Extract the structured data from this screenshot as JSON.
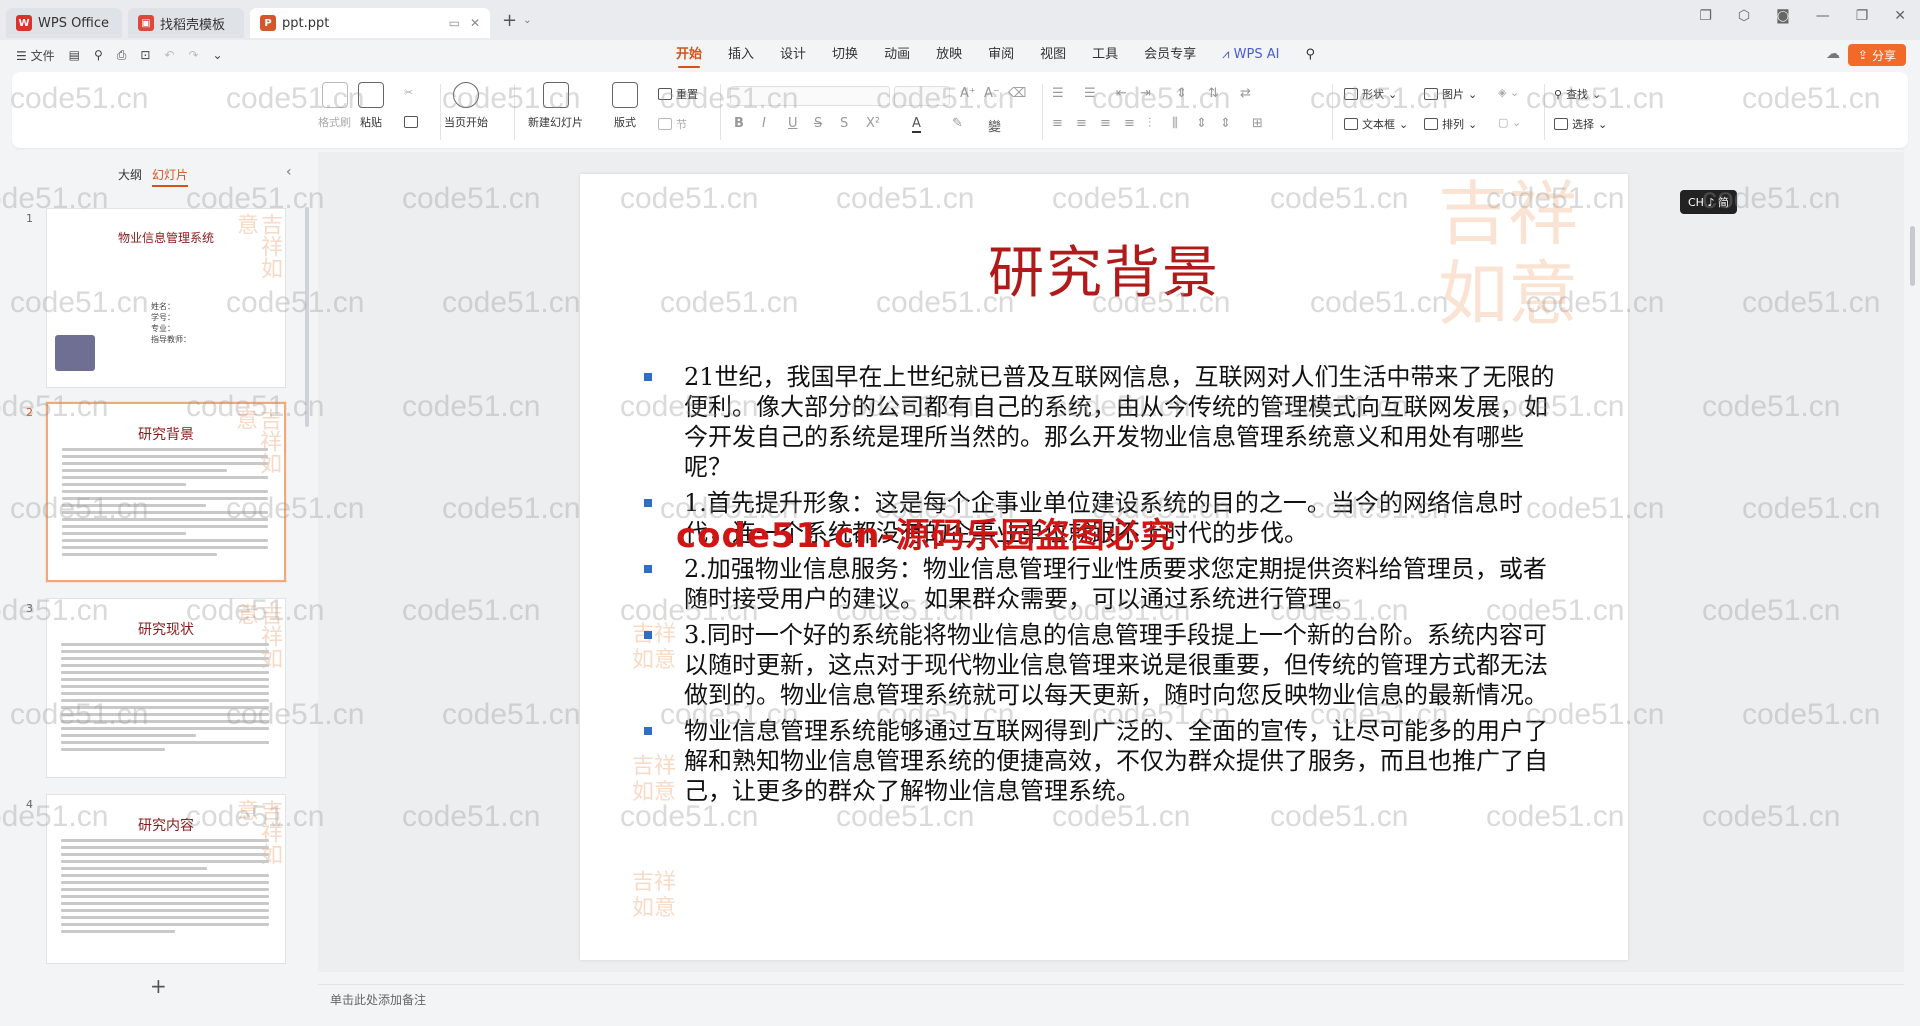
{
  "titlebar": {
    "tabs": [
      {
        "label": "WPS Office",
        "icon": "wps-logo-icon",
        "active": false
      },
      {
        "label": "找稻壳模板",
        "icon": "template-icon",
        "active": false
      },
      {
        "label": "ppt.ppt",
        "icon": "ppt-file-icon",
        "active": true
      }
    ]
  },
  "menubar": {
    "file_label": "文件",
    "tabs": [
      "开始",
      "插入",
      "设计",
      "切换",
      "动画",
      "放映",
      "审阅",
      "视图",
      "工具",
      "会员专享"
    ],
    "wps_ai": "WPS AI",
    "share": "分享"
  },
  "ribbon": {
    "format_painter": "格式刷",
    "paste": "粘贴",
    "play_current": "当页开始",
    "new_slide": "新建幻灯片",
    "layout": "版式",
    "reset": "重置",
    "section": "节",
    "shape": "形状",
    "picture": "图片",
    "textbox": "文本框",
    "arrange": "排列",
    "find": "查找",
    "select": "选择"
  },
  "leftpanel": {
    "tab_outline": "大纲",
    "tab_slides": "幻灯片",
    "slides": [
      {
        "num": "1",
        "title": "物业信息管理系统",
        "info": [
          "姓名：",
          "学号：",
          "专业：",
          "指导教师："
        ]
      },
      {
        "num": "2",
        "title": "研究背景"
      },
      {
        "num": "3",
        "title": "研究现状"
      },
      {
        "num": "4",
        "title": "研究内容"
      }
    ]
  },
  "slide": {
    "title": "研究背景",
    "bullets": [
      "21世纪，我国早在上世纪就已普及互联网信息，互联网对人们生活中带来了无限的便利。像大部分的公司都有自己的系统，由从今传统的管理模式向互联网发展，如今开发自己的系统是理所当然的。那么开发物业信息管理系统意义和用处有哪些呢？",
      "1.首先提升形象：这是每个企事业单位建设系统的目的之一。当今的网络信息时代，连一个系统都没有的企事业单位就跟不上时代的步伐。",
      "2.加强物业信息服务：物业信息管理行业性质要求您定期提供资料给管理员，或者随时接受用户的建议。如果群众需要，可以通过系统进行管理。",
      "3.同时一个好的系统能将物业信息的信息管理手段提上一个新的台阶。系统内容可以随时更新，这点对于现代物业信息管理来说是很重要，但传统的管理方式都无法做到的。物业信息管理系统就可以每天更新，随时向您反映物业信息的最新情况。",
      "物业信息管理系统能够通过互联网得到广泛的、全面的宣传，让尽可能多的用户了解和熟知物业信息管理系统的便捷高效，不仅为群众提供了服务，而且也推广了自己，让更多的群众了解物业信息管理系统。"
    ],
    "overlay_text": "code51.cn-源码乐园盗图必究"
  },
  "ime_badge": "CH ♪ 简",
  "notes_placeholder": "单击此处添加备注",
  "watermark_text": "code51.cn",
  "colors": {
    "accent": "#d4541a",
    "title_red": "#b01a1a",
    "bullet_blue": "#2f6ec0"
  }
}
